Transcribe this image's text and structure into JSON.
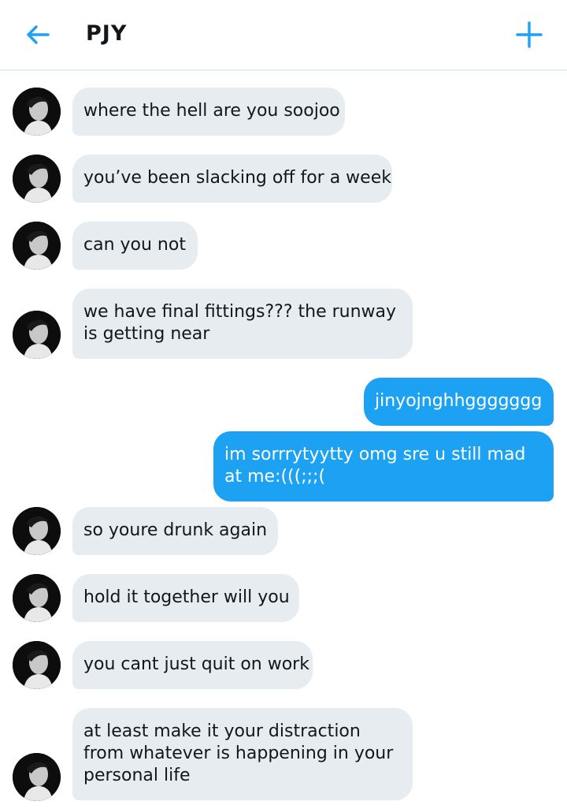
{
  "header": {
    "title": "PJY",
    "back_icon": "arrow-left-icon",
    "new_icon": "plus-icon",
    "accent": "#1da1f2"
  },
  "colors": {
    "incoming_bubble": "#e6ecf0",
    "outgoing_bubble": "#1da1f2"
  },
  "messages": [
    {
      "from": "them",
      "lines": [
        "where the hell are you soojoo"
      ]
    },
    {
      "from": "them",
      "lines": [
        "you’ve been slacking off for a week"
      ]
    },
    {
      "from": "them",
      "lines": [
        "can you not"
      ]
    },
    {
      "from": "them",
      "lines": [
        "we have final fittings??? the runway",
        "is getting near"
      ]
    },
    {
      "from": "me",
      "lines": [
        "jinyojnghhggggggg"
      ]
    },
    {
      "from": "me",
      "lines": [
        "im sorrrytyytty omg sre u still mad",
        "at me:(((;;;("
      ]
    },
    {
      "from": "them",
      "lines": [
        "so youre drunk again"
      ]
    },
    {
      "from": "them",
      "lines": [
        "hold it together will you"
      ]
    },
    {
      "from": "them",
      "lines": [
        "you cant just quit on work"
      ]
    },
    {
      "from": "them",
      "lines": [
        "at least make it your distraction",
        "from whatever is happening in your",
        "personal life"
      ]
    }
  ]
}
